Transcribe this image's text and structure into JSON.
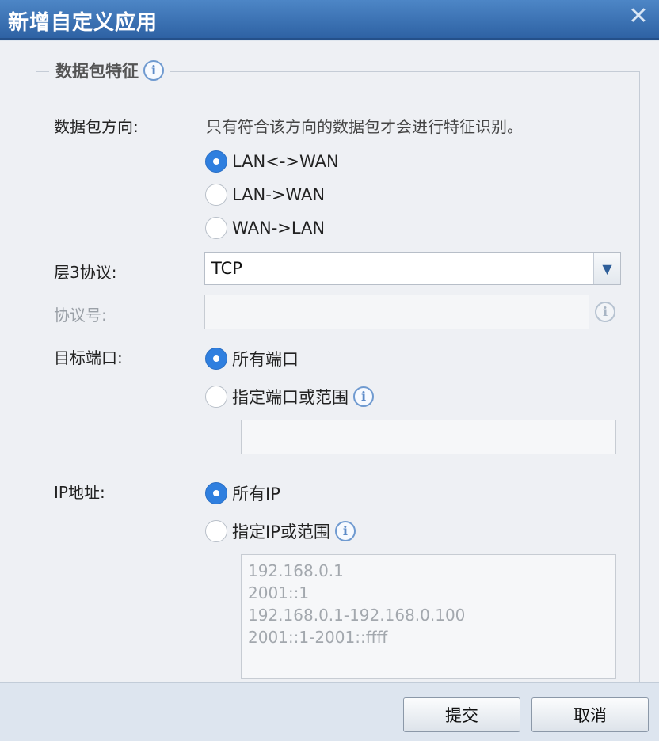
{
  "dialog": {
    "title": "新增自定义应用",
    "close_glyph": "✕"
  },
  "section": {
    "legend": "数据包特征"
  },
  "direction": {
    "label": "数据包方向:",
    "hint": "只有符合该方向的数据包才会进行特征识别。",
    "options": [
      {
        "label": "LAN<->WAN",
        "checked": true
      },
      {
        "label": "LAN->WAN",
        "checked": false
      },
      {
        "label": "WAN->LAN",
        "checked": false
      }
    ]
  },
  "layer3": {
    "label": "层3协议:",
    "value": "TCP"
  },
  "protocol_number": {
    "label": "协议号:",
    "value": ""
  },
  "dest_port": {
    "label": "目标端口:",
    "options": [
      {
        "label": "所有端口",
        "checked": true
      },
      {
        "label": "指定端口或范围",
        "checked": false
      }
    ],
    "value": ""
  },
  "ip": {
    "label": "IP地址:",
    "options": [
      {
        "label": "所有IP",
        "checked": true
      },
      {
        "label": "指定IP或范围",
        "checked": false
      }
    ],
    "placeholder": "192.168.0.1\n2001::1\n192.168.0.1-192.168.0.100\n2001::1-2001::ffff"
  },
  "buttons": {
    "submit": "提交",
    "cancel": "取消"
  }
}
